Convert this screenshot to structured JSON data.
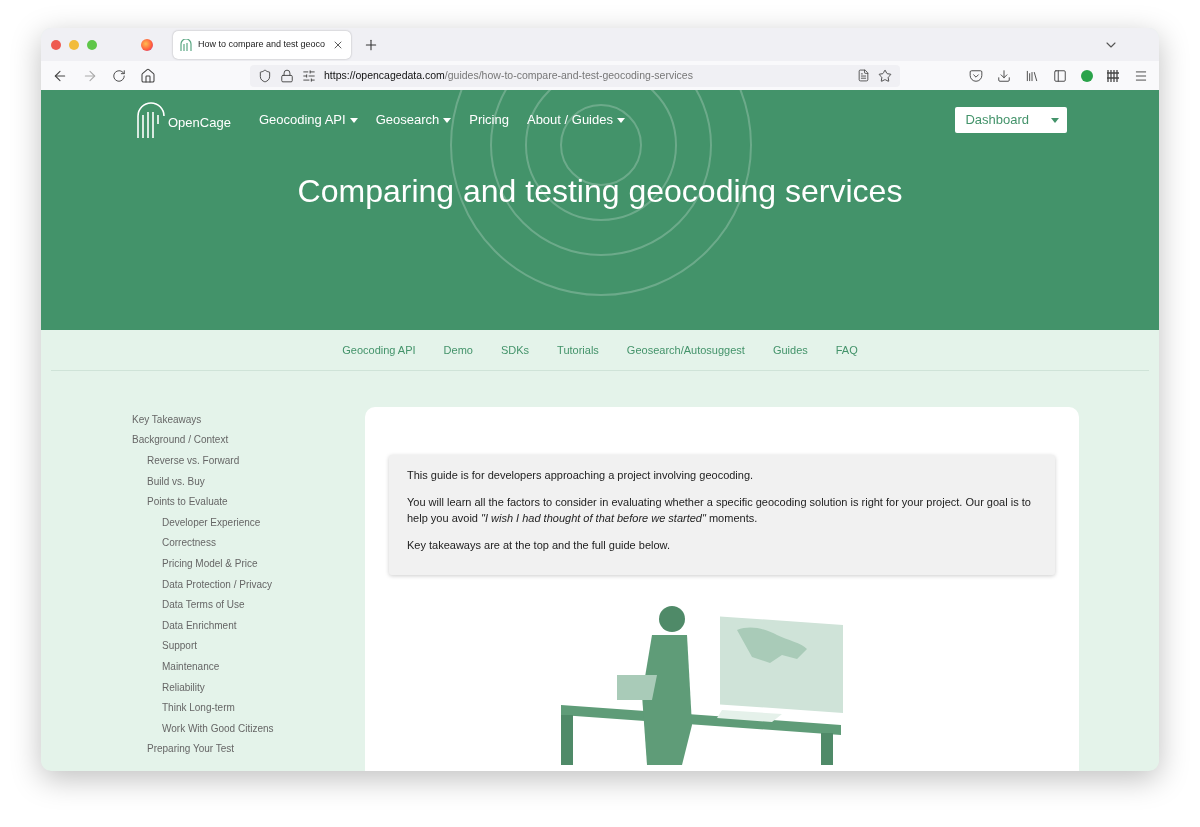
{
  "browser": {
    "tab_title": "How to compare and test geoco",
    "url_domain": "https://opencagedata.com",
    "url_path": "/guides/how-to-compare-and-test-geocoding-services"
  },
  "site_nav": {
    "logo_text": "OpenCage",
    "items": [
      {
        "label": "Geocoding API",
        "dropdown": true
      },
      {
        "label": "Geosearch",
        "dropdown": true
      },
      {
        "label": "Pricing",
        "dropdown": false
      },
      {
        "label": "About / Guides",
        "dropdown": true
      }
    ],
    "dashboard_button": "Dashboard"
  },
  "hero": {
    "title": "Comparing and testing geocoding services"
  },
  "sub_nav": [
    "Geocoding API",
    "Demo",
    "SDKs",
    "Tutorials",
    "Geosearch/Autosuggest",
    "Guides",
    "FAQ"
  ],
  "toc": [
    {
      "label": "Key Takeaways"
    },
    {
      "label": "Background / Context",
      "children": [
        {
          "label": "Reverse vs. Forward"
        },
        {
          "label": "Build vs. Buy"
        },
        {
          "label": "Points to Evaluate",
          "children": [
            {
              "label": "Developer Experience"
            },
            {
              "label": "Correctness"
            },
            {
              "label": "Pricing Model & Price"
            },
            {
              "label": "Data Protection / Privacy"
            },
            {
              "label": "Data Terms of Use"
            },
            {
              "label": "Data Enrichment"
            },
            {
              "label": "Support"
            },
            {
              "label": "Maintenance"
            },
            {
              "label": "Reliability"
            },
            {
              "label": "Think Long-term"
            },
            {
              "label": "Work With Good Citizens"
            }
          ]
        },
        {
          "label": "Preparing Your Test"
        }
      ]
    }
  ],
  "intro": [
    "This guide is for developers approaching a project involving geocoding.",
    "You will learn all the factors to consider in evaluating whether a specific geocoding solution is right for your project. Our goal is to help you avoid *\"I wish I had thought of that before we started\"* moments.",
    "Key takeaways are at the top and the full guide below."
  ]
}
